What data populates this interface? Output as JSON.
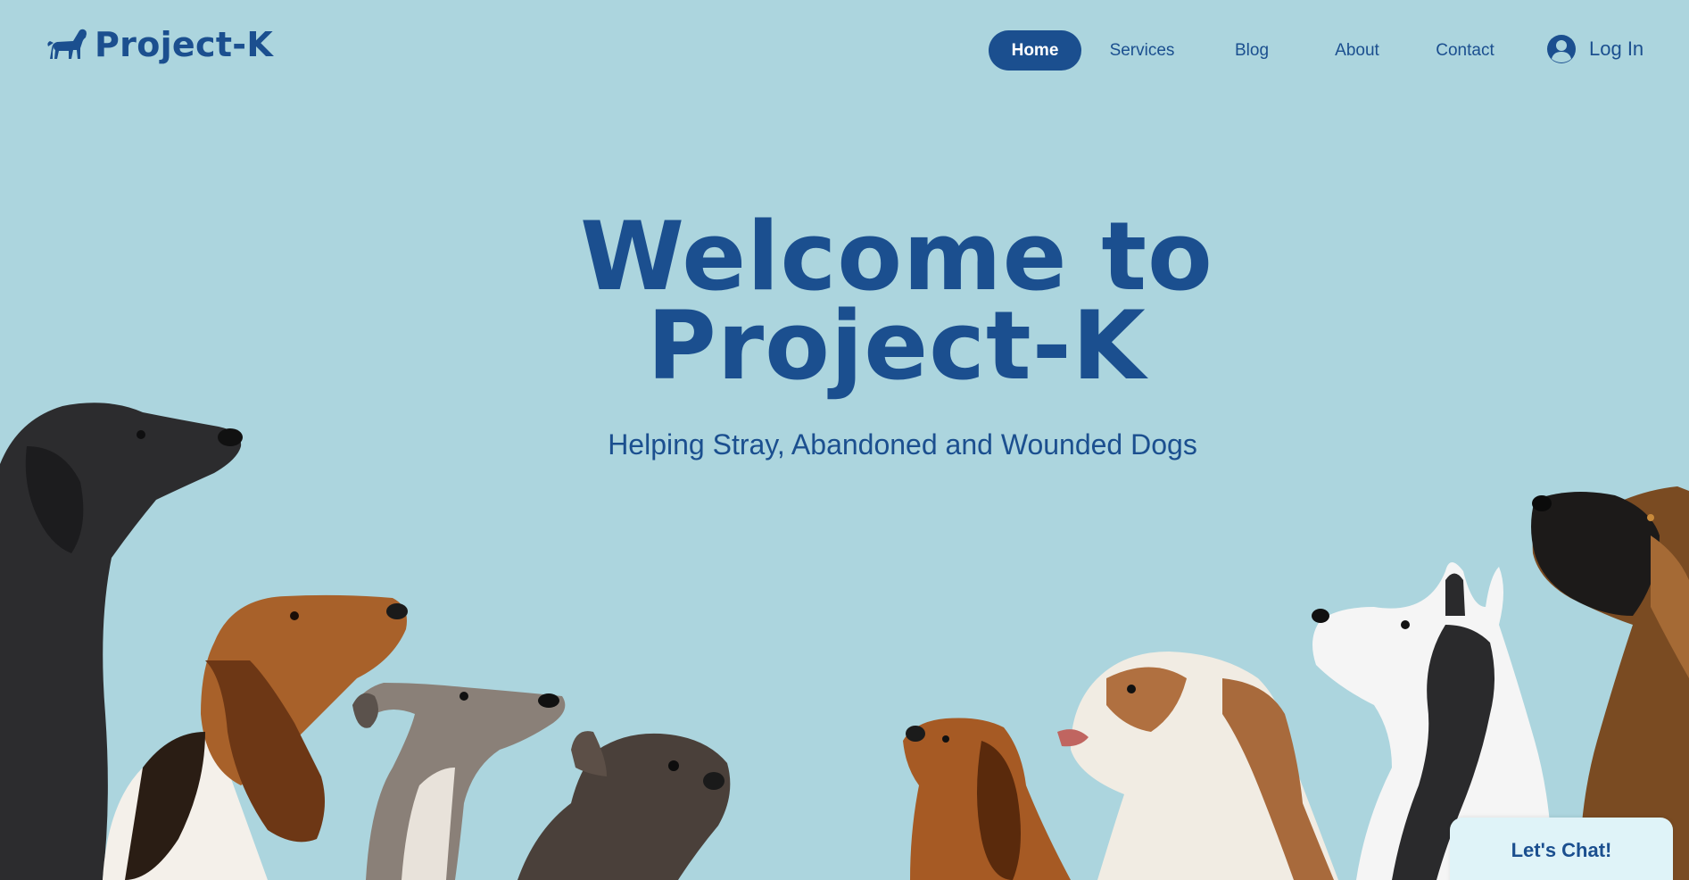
{
  "brand": {
    "name": "Project-K",
    "logo_icon": "dog-silhouette-icon"
  },
  "nav": {
    "items": [
      {
        "label": "Home",
        "active": true
      },
      {
        "label": "Services",
        "active": false
      },
      {
        "label": "Blog",
        "active": false
      },
      {
        "label": "About",
        "active": false
      },
      {
        "label": "Contact",
        "active": false
      }
    ]
  },
  "login": {
    "label": "Log In",
    "icon": "user-avatar-icon"
  },
  "hero": {
    "title_line1": "Welcome to",
    "title_line2": "Project-K",
    "subtitle": "Helping Stray, Abandoned and Wounded Dogs"
  },
  "chat": {
    "label": "Let's Chat!"
  },
  "colors": {
    "background": "#acd5de",
    "brand_blue": "#1b4f8f",
    "chat_bg": "#dff3f8"
  }
}
